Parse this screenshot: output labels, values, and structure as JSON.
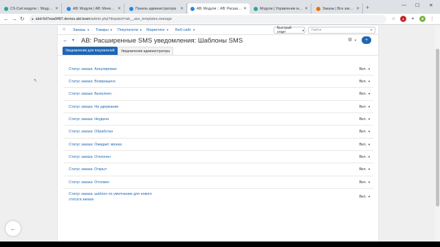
{
  "browser": {
    "tabs": [
      {
        "title": "CS-Cart модули :: Модуль - Ра",
        "fav": "green"
      },
      {
        "title": "AB: Модули | AB: Менеджер м",
        "fav": "blue"
      },
      {
        "title": "Панель администратора",
        "fav": "blue"
      },
      {
        "title": "AB: Модули :: AB: Расширенны",
        "fav": "blue"
      },
      {
        "title": "Модули | Управление модулями",
        "fav": "green"
      },
      {
        "title": "Заказы | Все заказы - Панель",
        "fav": "orange"
      }
    ],
    "new_tab": "+",
    "url_host": "abd-5d7eaa9487.demos.abt.team",
    "url_path": "/admin.php?dispatch=ab__asn_templates.manage"
  },
  "admin": {
    "nav": {
      "orders": "Заказы",
      "products": "Товары",
      "customers": "Покупатели",
      "marketing": "Маркетинг",
      "website": "Веб-сайт",
      "quick_start": "Быстрый старт",
      "search_placeholder": "Найти"
    },
    "page_title": "AB: Расширенные SMS уведомления: Шаблоны SMS",
    "tabs": {
      "customers": "Уведомления для покупателей",
      "admin": "Уведомления администратора"
    },
    "rows": [
      {
        "label": "Статус заказа: Аннулирован",
        "status": "Вкл."
      },
      {
        "label": "Статус заказа: Возвращено",
        "status": "Вкл."
      },
      {
        "label": "Статус заказа: Выполнен",
        "status": "Вкл."
      },
      {
        "label": "Статус заказа: На удержании",
        "status": "Вкл."
      },
      {
        "label": "Статус заказа: Неудача",
        "status": "Вкл."
      },
      {
        "label": "Статус заказа: Обработан",
        "status": "Вкл."
      },
      {
        "label": "Статус заказа: Ожидает звонка",
        "status": "Вкл."
      },
      {
        "label": "Статус заказа: Отклонен",
        "status": "Вкл."
      },
      {
        "label": "Статус заказа: Открыт",
        "status": "Вкл."
      },
      {
        "label": "Статус заказа: Отложен",
        "status": "Вкл."
      }
    ],
    "last_row": {
      "line1": "Статус заказа: шаблон по умолчанию для нового",
      "line2": "статуса заказа",
      "status": "Вкл."
    }
  }
}
